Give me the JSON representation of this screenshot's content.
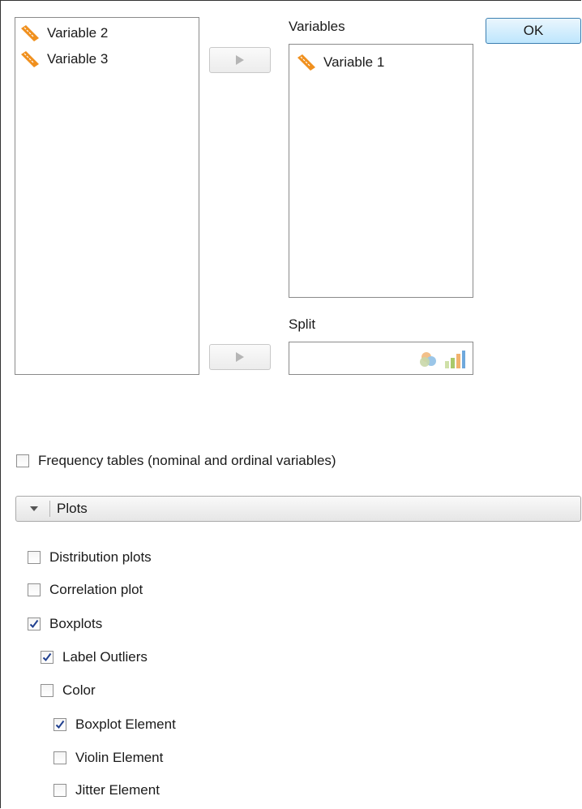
{
  "available_variables": {
    "items": [
      {
        "label": "Variable 2",
        "icon": "ruler-icon"
      },
      {
        "label": "Variable 3",
        "icon": "ruler-icon"
      }
    ]
  },
  "variables_box": {
    "title": "Variables",
    "items": [
      {
        "label": "Variable 1",
        "icon": "ruler-icon"
      }
    ]
  },
  "split_box": {
    "title": "Split",
    "icons": [
      "nominal-ordinal-icon",
      "bar-chart-icon"
    ]
  },
  "ok_button": {
    "label": "OK"
  },
  "frequency_tables": {
    "label": "Frequency tables (nominal and ordinal variables)",
    "checked": false
  },
  "plots_section": {
    "title": "Plots",
    "expanded": true,
    "options": {
      "distribution_plots": {
        "label": "Distribution plots",
        "checked": false
      },
      "correlation_plot": {
        "label": "Correlation plot",
        "checked": false
      },
      "boxplots": {
        "label": "Boxplots",
        "checked": true
      },
      "label_outliers": {
        "label": "Label Outliers",
        "checked": true
      },
      "color": {
        "label": "Color",
        "checked": false
      },
      "boxplot_element": {
        "label": "Boxplot Element",
        "checked": true
      },
      "violin_element": {
        "label": "Violin Element",
        "checked": false
      },
      "jitter_element": {
        "label": "Jitter Element",
        "checked": false
      }
    }
  },
  "colors": {
    "ruler_orange": "#f0901e",
    "check_blue": "#1f3f8f",
    "ok_border": "#3c7fb1"
  }
}
